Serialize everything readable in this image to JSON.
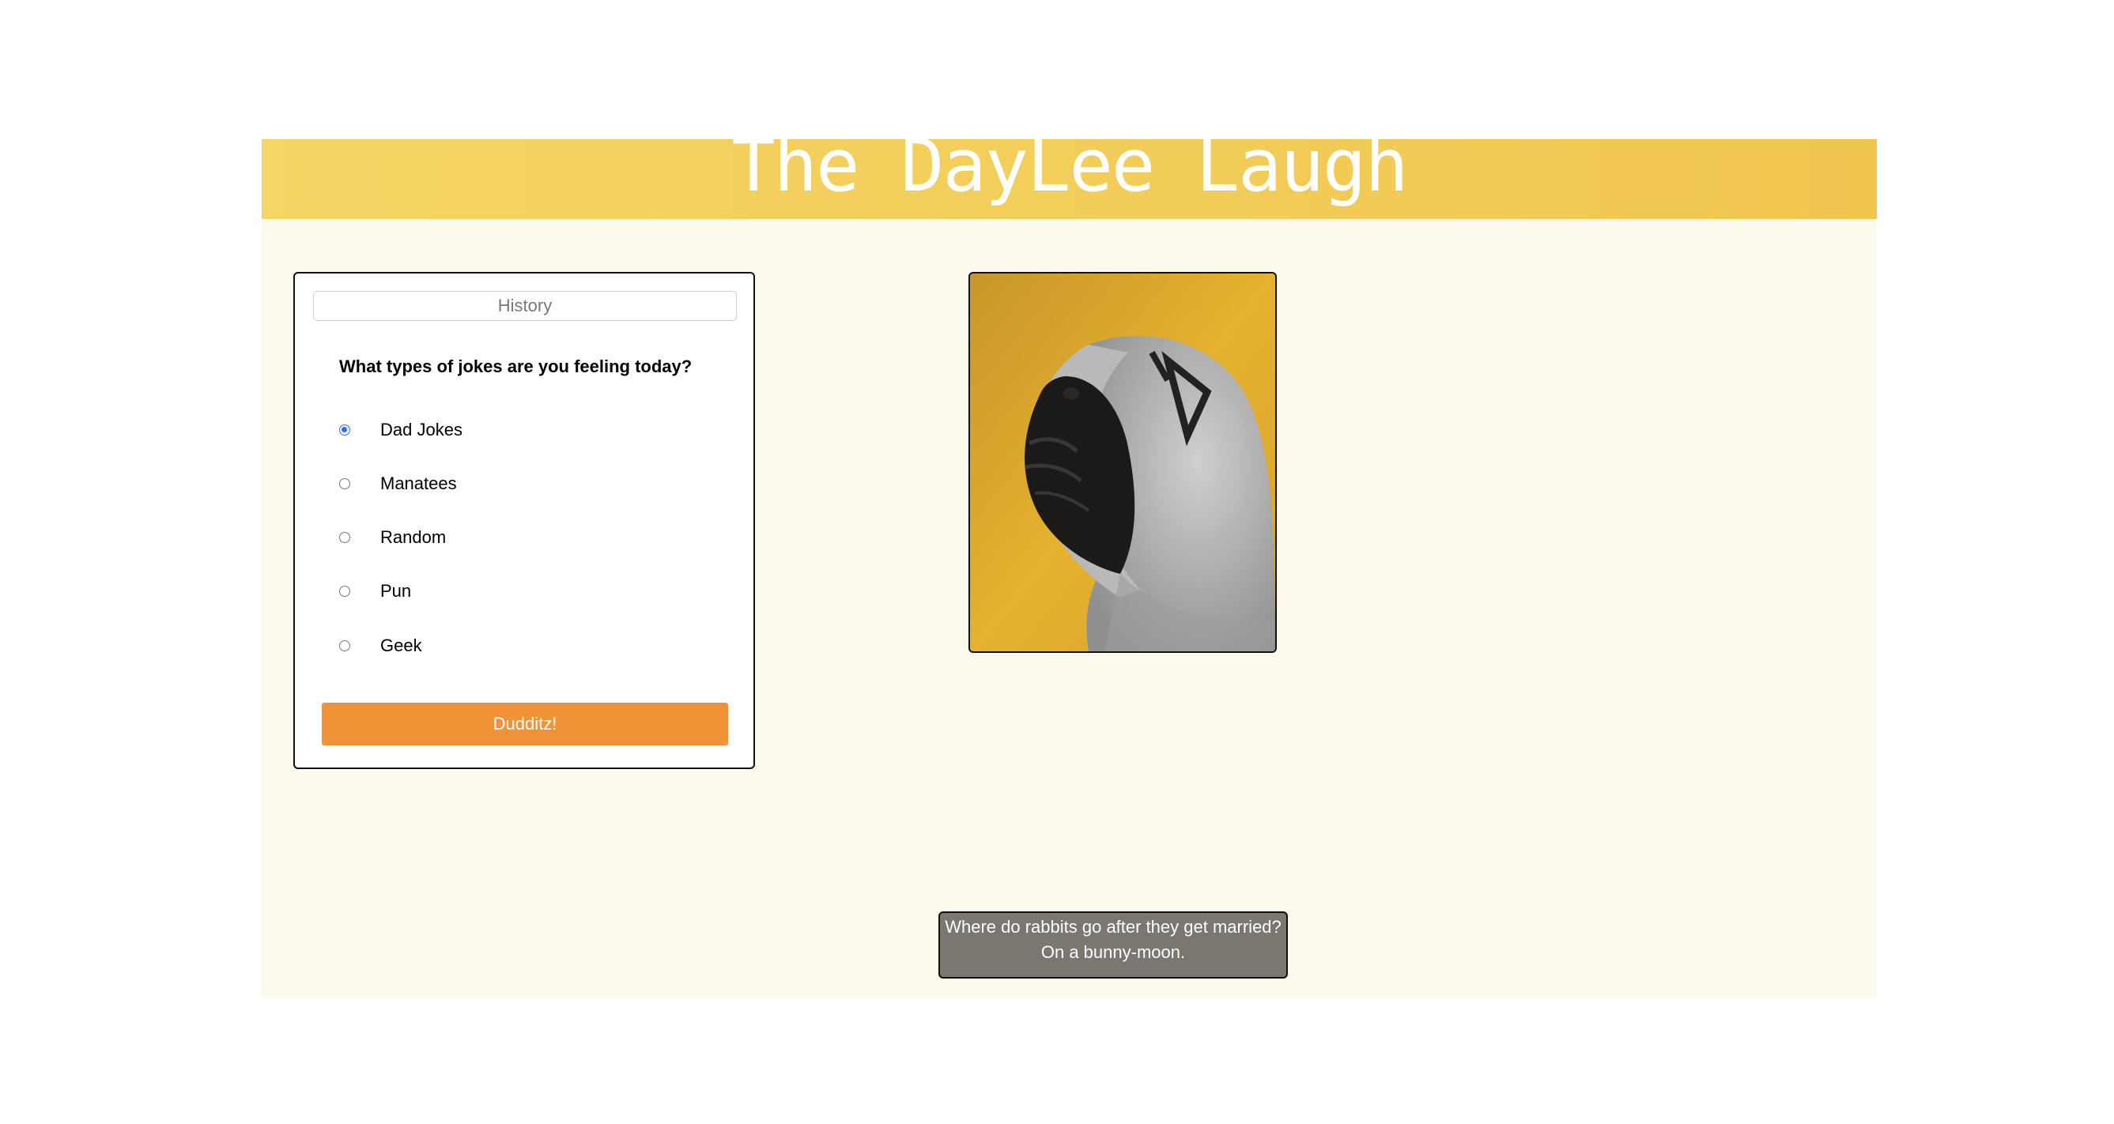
{
  "header": {
    "title": "The DayLee Laugh"
  },
  "quiz": {
    "history_label": "History",
    "question": "What types of jokes are you feeling today?",
    "options": [
      {
        "label": "Dad Jokes",
        "selected": true
      },
      {
        "label": "Manatees",
        "selected": false
      },
      {
        "label": "Random",
        "selected": false
      },
      {
        "label": "Pun",
        "selected": false
      },
      {
        "label": "Geek",
        "selected": false
      }
    ],
    "submit_label": "Dudditz!"
  },
  "photo": {
    "subject": "pug-in-hoodie"
  },
  "joke": {
    "setup": "Where do rabbits go after they get married?",
    "punchline": "On a bunny-moon."
  },
  "colors": {
    "header_start": "#f4d565",
    "header_end": "#f1c64f",
    "page_bg": "#fdf9ec",
    "accent": "#f09235",
    "radio_selected": "#2b6ee8",
    "joke_bg": "#7a7670"
  }
}
